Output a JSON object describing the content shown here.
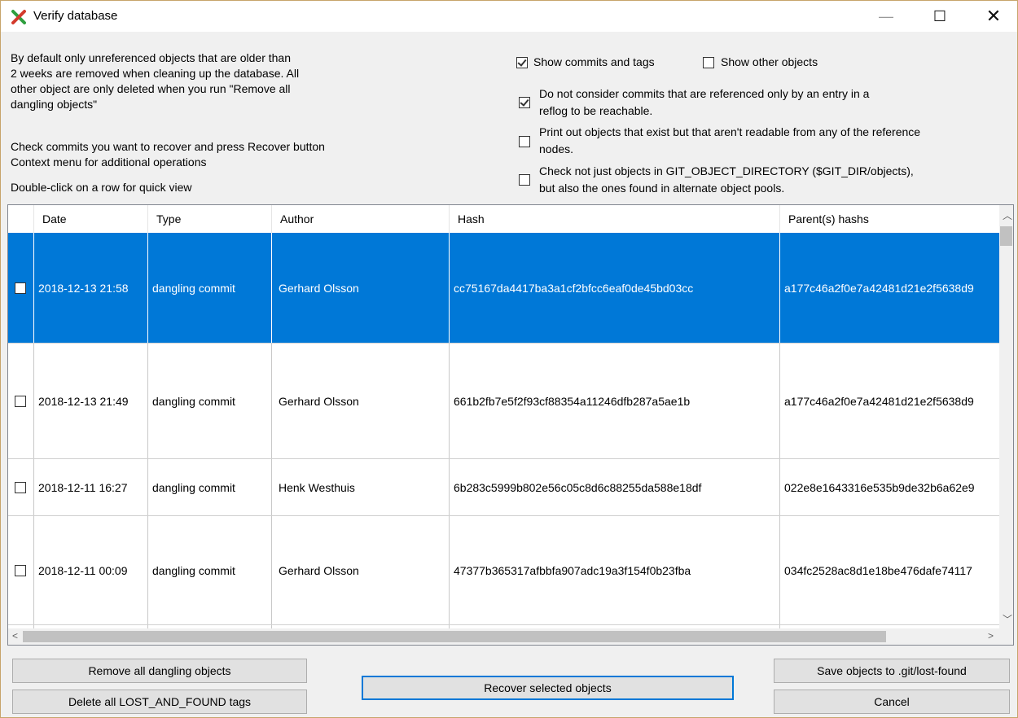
{
  "window": {
    "title": "Verify database"
  },
  "info": {
    "line1": "By default only unreferenced objects that are older than",
    "line2": "2 weeks are removed when cleaning up the database. All",
    "line3": "other object are only deleted when you run \"Remove all",
    "line4": "dangling objects\"",
    "line5": "Check commits you want to recover and press Recover button",
    "line6": "Context menu for additional operations",
    "line7": "Double-click on a row for quick view"
  },
  "options": {
    "show_commits": {
      "label": "Show commits and tags",
      "checked": true
    },
    "show_other": {
      "label": "Show other objects",
      "checked": false
    },
    "no_reflog": {
      "line1": "Do not consider commits that are referenced only by an entry in a",
      "line2": "reflog to be reachable.",
      "checked": true
    },
    "print_unreadable": {
      "line1": "Print out objects that exist but that aren't readable from any of the reference",
      "line2": "nodes.",
      "checked": false
    },
    "alternate_pools": {
      "line1": "Check not just objects in GIT_OBJECT_DIRECTORY ($GIT_DIR/objects),",
      "line2": "but also the ones found in alternate object pools.",
      "checked": false
    }
  },
  "grid": {
    "columns": [
      "Date",
      "Type",
      "Author",
      "Hash",
      "Parent(s) hashs"
    ],
    "rows": [
      {
        "date": "2018-12-13 21:58",
        "type": "dangling commit",
        "author": "Gerhard Olsson",
        "hash": "cc75167da4417ba3a1cf2bfcc6eaf0de45bd03cc",
        "parents": "a177c46a2f0e7a42481d21e2f5638d9",
        "selected": true,
        "checked": false
      },
      {
        "date": "2018-12-13 21:49",
        "type": "dangling commit",
        "author": "Gerhard Olsson",
        "hash": "661b2fb7e5f2f93cf88354a11246dfb287a5ae1b",
        "parents": "a177c46a2f0e7a42481d21e2f5638d9",
        "selected": false,
        "checked": false
      },
      {
        "date": "2018-12-11 16:27",
        "type": "dangling commit",
        "author": "Henk Westhuis",
        "hash": "6b283c5999b802e56c05c8d6c88255da588e18df",
        "parents": "022e8e1643316e535b9de32b6a62e9",
        "selected": false,
        "checked": false
      },
      {
        "date": "2018-12-11 00:09",
        "type": "dangling commit",
        "author": "Gerhard Olsson",
        "hash": "47377b365317afbbfa907adc19a3f154f0b23fba",
        "parents": "034fc2528ac8d1e18be476dafe74117",
        "selected": false,
        "checked": false
      }
    ]
  },
  "buttons": {
    "remove_all": "Remove all dangling objects",
    "delete_tags": "Delete all LOST_AND_FOUND tags",
    "recover": "Recover selected objects",
    "save_lost_found": "Save objects to .git/lost-found",
    "cancel": "Cancel"
  },
  "colors": {
    "selection": "#0078d7",
    "icon_green": "#2e9e3e",
    "icon_red": "#d33a2c"
  }
}
